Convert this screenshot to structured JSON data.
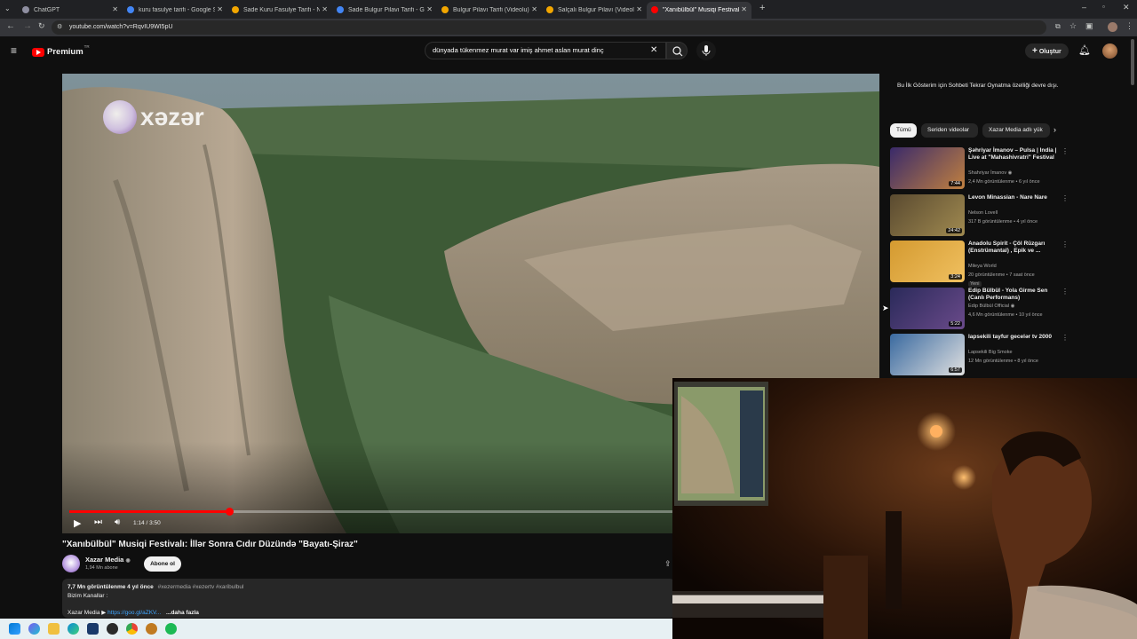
{
  "browser": {
    "tabs": [
      {
        "label": "ChatGPT",
        "color": "#8e8ea0"
      },
      {
        "label": "kuru fasulye tarifi - Google Sea",
        "color": "#4285f4"
      },
      {
        "label": "Sade Kuru Fasulye Tarifi - Nefi",
        "color": "#f2a600"
      },
      {
        "label": "Sade Bulgur Pilavı Tarifi - Goog",
        "color": "#4285f4"
      },
      {
        "label": "Bulgur Pilavı Tarifi (Videolu) - N",
        "color": "#f2a600"
      },
      {
        "label": "Salçalı Bulgur Pilavı (Videolu) ",
        "color": "#f2a600"
      },
      {
        "label": "\"Xanıbülbül\" Musiqi Festivalı: İlll",
        "color": "#ff0000"
      }
    ],
    "url": "youtube.com/watch?v=RqvIU9WI5pU"
  },
  "masthead": {
    "logo_text": "Premium",
    "logo_sup": "TR",
    "search_value": "dünyada tükenmez murat var imiş ahmet aslan murat dinç",
    "create_label": "Oluştur"
  },
  "video": {
    "watermark": "xəzər",
    "time": "1:14 / 3:50",
    "progress_fraction": 0.197,
    "title": "\"Xanıbülbül\" Musiqi Festivalı: İllər Sonra Cıdır Düzündə \"Bayatı-Şiraz\"",
    "channel_name": "Xazar Media",
    "subscribers": "1,94 Mn abone",
    "subscribe_label": "Abone ol",
    "views_line": "7,7 Mn görüntülenme  4 yıl önce",
    "hashtags": "#xezermedia #xezertv #xaribulbul",
    "desc_line2": "Bizim Kanallar :",
    "desc_line3_prefix": "Xazar Media ▶",
    "desc_link": "https://goo.gl/aZKV...",
    "more_label": "...daha fazla"
  },
  "sidebar": {
    "note": "Bu İlk Gösterim için Sohbeti Tekrar Oynatma özelliği devre dışı.",
    "chips": [
      "Tümü",
      "Seriden videolar",
      "Xazar Media adlı yük"
    ],
    "recs": [
      {
        "title": "Şəhriyar İmanov – Pulsa | India | Live at \"Mahashivratri\" Festival",
        "channel": "Shahriyar İmanov ◉",
        "meta": "2,4 Mn görüntülenme • 6 yıl önce",
        "duration": "7:44",
        "colors": [
          "#3a2a6a",
          "#c08040"
        ]
      },
      {
        "title": "Levon Minassian - Nare Nare",
        "channel": "Nelson Lovell",
        "meta": "317 B görüntülenme • 4 yıl önce",
        "duration": "24:42",
        "colors": [
          "#5a4a30",
          "#a08a50"
        ]
      },
      {
        "title": "Anadolu Spirit - Çöl Rüzgarı (Enstrümantal) , Epik ve ...",
        "channel": "Mileya World",
        "meta": "20 görüntülenme • 7 saat önce",
        "extra": "Yeni",
        "duration": "3:24",
        "colors": [
          "#d49a30",
          "#f0c060"
        ]
      },
      {
        "title": "Edip Bülbül - Yola Girme Sen (Canlı Performans)",
        "channel": "Edip Bülbül Official ◉",
        "meta": "4,6 Mn görüntülenme • 10 yıl önce",
        "duration": "5:22",
        "colors": [
          "#2a2a5a",
          "#6a4a8a"
        ]
      },
      {
        "title": "lapsekili tayfur gecelər tv 2000",
        "channel": "Lapsekili Big Smoke",
        "meta": "12 Mn görüntülenme • 8 yıl önce",
        "duration": "6:57",
        "colors": [
          "#3a6aa0",
          "#e0e0e0"
        ]
      }
    ]
  }
}
